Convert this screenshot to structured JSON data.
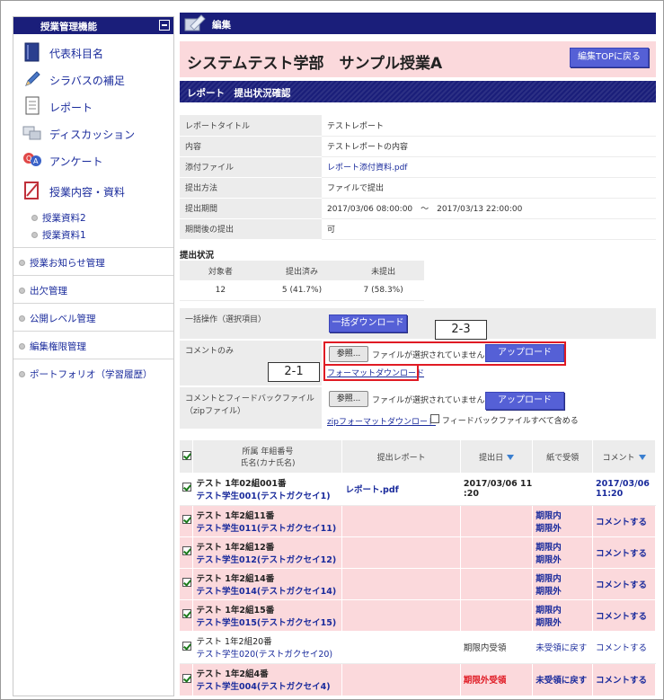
{
  "sidebar": {
    "header": "授業管理機能",
    "items": [
      {
        "label": "代表科目名",
        "icon": "book-icon"
      },
      {
        "label": "シラバスの補足",
        "icon": "pencil-icon"
      },
      {
        "label": "レポート",
        "icon": "document-icon"
      },
      {
        "label": "ディスカッション",
        "icon": "discussion-icon"
      },
      {
        "label": "アンケート",
        "icon": "qa-icon"
      },
      {
        "label": "授業内容・資料",
        "icon": "notebook-icon"
      }
    ],
    "sub_items": [
      "授業資料2",
      "授業資料1"
    ],
    "links": [
      "授業お知らせ管理",
      "出欠管理",
      "公開レベル管理",
      "編集権限管理",
      "ポートフォリオ（学習履歴）"
    ]
  },
  "header": {
    "title": "編集"
  },
  "course": {
    "title": "システムテスト学部　サンプル授業A",
    "back_button": "編集TOPに戻る"
  },
  "section": {
    "title": "レポート　提出状況確認"
  },
  "info": [
    {
      "key": "レポートタイトル",
      "value": "テストレポート"
    },
    {
      "key": "内容",
      "value": "テストレポートの内容"
    },
    {
      "key": "添付ファイル",
      "value": "レポート添付資料.pdf"
    },
    {
      "key": "提出方法",
      "value": "ファイルで提出"
    },
    {
      "key": "提出期間",
      "value": "2017/03/06 08:00:00　～　2017/03/13 22:00:00"
    },
    {
      "key": "期間後の提出",
      "value": "可"
    }
  ],
  "status": {
    "title": "提出状況",
    "headers": [
      "対象者",
      "提出済み",
      "未提出"
    ],
    "values": [
      "12",
      "5 (41.7%)",
      "7 (58.3%)"
    ]
  },
  "ops": {
    "bulk_label": "一括操作（選択項目）",
    "bulk_button": "一括ダウンロード",
    "comment_label": "コメントのみ",
    "browse": "参照...",
    "no_file": "ファイルが選択されていません",
    "upload": "アップロード",
    "format_download": "フォーマットダウンロード",
    "fb_label_1": "コメントとフィードバックファイル",
    "fb_label_2": "（zipファイル）",
    "zip_download": "zipフォーマットダウンロード",
    "include_all": "フィードバックファイルすべて含める"
  },
  "callouts": {
    "c1": "2-1",
    "c2": "2-3"
  },
  "table": {
    "headers": {
      "affiliation_1": "所属 年組番号",
      "affiliation_2": "氏名(カナ氏名)",
      "report": "提出レポート",
      "date": "提出日",
      "paper": "紙で受領",
      "comment": "コメント"
    },
    "rows": [
      {
        "line1": "テスト 1年02組001番",
        "line2": "テスト学生001(テストガクセイ1)",
        "report": "レポート.pdf",
        "date1": "2017/03/06 11",
        "date2": ":20",
        "paper1": "",
        "paper2": "",
        "comment1": "2017/03/06",
        "comment2": "11:20"
      },
      {
        "line1": "テスト 1年2組11番",
        "line2": "テスト学生011(テストガクセイ11)",
        "report": "",
        "date1": "",
        "date2": "",
        "paper1": "期限内",
        "paper2": "期限外",
        "comment1": "コメントする",
        "comment2": ""
      },
      {
        "line1": "テスト 1年2組12番",
        "line2": "テスト学生012(テストガクセイ12)",
        "report": "",
        "date1": "",
        "date2": "",
        "paper1": "期限内",
        "paper2": "期限外",
        "comment1": "コメントする",
        "comment2": ""
      },
      {
        "line1": "テスト 1年2組14番",
        "line2": "テスト学生014(テストガクセイ14)",
        "report": "",
        "date1": "",
        "date2": "",
        "paper1": "期限内",
        "paper2": "期限外",
        "comment1": "コメントする",
        "comment2": ""
      },
      {
        "line1": "テスト 1年2組15番",
        "line2": "テスト学生015(テストガクセイ15)",
        "report": "",
        "date1": "",
        "date2": "",
        "paper1": "期限内",
        "paper2": "期限外",
        "comment1": "コメントする",
        "comment2": ""
      },
      {
        "line1": "テスト 1年2組20番",
        "line2": "テスト学生020(テストガクセイ20)",
        "report": "",
        "date1": "期限内受領",
        "date2": "",
        "paper1": "未受領に戻す",
        "paper2": "",
        "comment1": "コメントする",
        "comment2": ""
      },
      {
        "line1": "テスト 1年2組4番",
        "line2": "テスト学生004(テストガクセイ4)",
        "report": "",
        "date1": "期限外受領",
        "date2": "",
        "paper1": "未受領に戻す",
        "paper2": "",
        "comment1": "コメントする",
        "comment2": ""
      }
    ]
  },
  "colors": {
    "navy": "#1a1e7a",
    "pink": "#fbd9dc",
    "button": "#5560d6",
    "link": "#1a2b9c",
    "highlight": "#e01b24"
  }
}
